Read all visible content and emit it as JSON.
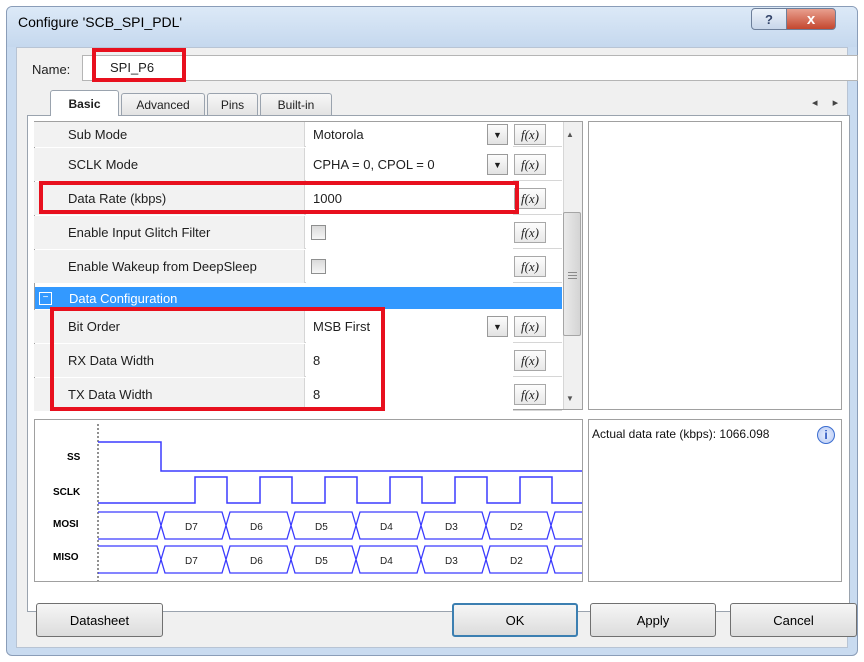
{
  "window": {
    "title": "Configure 'SCB_SPI_PDL'",
    "help_glyph": "?",
    "close_glyph": "x"
  },
  "name": {
    "label": "Name:",
    "value": "SPI_P6"
  },
  "tabs": [
    {
      "label": "Basic"
    },
    {
      "label": "Advanced"
    },
    {
      "label": "Pins"
    },
    {
      "label": "Built-in"
    }
  ],
  "tab_scroll": "◂ ▸",
  "properties": [
    {
      "name": "Sub Mode",
      "value": "Motorola",
      "fx": "f(x)"
    },
    {
      "name": "SCLK Mode",
      "value": "CPHA = 0, CPOL = 0",
      "fx": "f(x)"
    },
    {
      "name": "Data Rate (kbps)",
      "value": "1000",
      "fx": "f(x)"
    },
    {
      "name": "Enable Input Glitch Filter",
      "value": "",
      "fx": "f(x)"
    },
    {
      "name": "Enable Wakeup from DeepSleep",
      "value": "",
      "fx": "f(x)"
    }
  ],
  "category": {
    "toggle": "−",
    "label": "Data Configuration"
  },
  "data_properties": [
    {
      "name": "Bit Order",
      "value": "MSB First",
      "fx": "f(x)"
    },
    {
      "name": "RX Data Width",
      "value": "8",
      "fx": "f(x)"
    },
    {
      "name": "TX Data Width",
      "value": "8",
      "fx": "f(x)"
    }
  ],
  "waveform": {
    "signals": [
      "SS",
      "SCLK",
      "MOSI",
      "MISO"
    ],
    "bits": [
      "D7",
      "D6",
      "D5",
      "D4",
      "D3",
      "D2"
    ]
  },
  "actual_rate": {
    "label": "Actual data rate (kbps):",
    "value": "1066.098",
    "info_glyph": "i"
  },
  "buttons": {
    "datasheet": "Datasheet",
    "ok": "OK",
    "apply": "Apply",
    "cancel": "Cancel"
  },
  "colors": {
    "highlight": "#e8101e",
    "category_bg": "#3399ff",
    "wave": "#3b3bff"
  }
}
